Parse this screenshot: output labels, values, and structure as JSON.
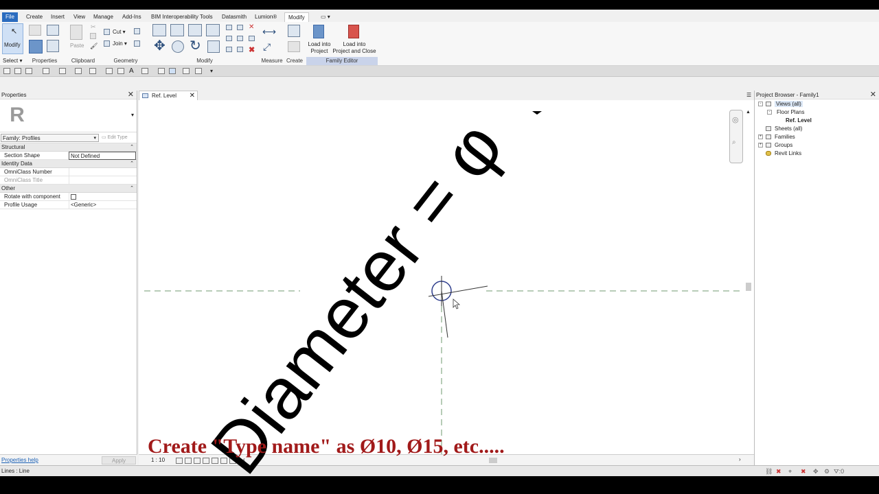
{
  "tabs": [
    "File",
    "Create",
    "Insert",
    "View",
    "Manage",
    "Add-Ins",
    "BIM Interoperability Tools",
    "Datasmith",
    "Lumion®",
    "Modify"
  ],
  "ribbon": {
    "modify_label": "Modify",
    "select_label": "Select",
    "cut_label": "Cut",
    "join_label": "Join",
    "paste_label": "Paste",
    "load_into_project": [
      "Load into",
      "Project"
    ],
    "load_into_project_close": [
      "Load into",
      "Project and Close"
    ],
    "panels": {
      "select": "Select",
      "properties": "Properties",
      "clipboard": "Clipboard",
      "geometry": "Geometry",
      "modify": "Modify",
      "measure": "Measure",
      "create": "Create",
      "family_editor": "Family Editor"
    }
  },
  "properties": {
    "title": "Properties",
    "family_selector": "Family: Profiles",
    "edit_type": "Edit Type",
    "groups": [
      {
        "name": "Structural",
        "rows": [
          {
            "k": "Section Shape",
            "v": "Not Defined"
          }
        ]
      },
      {
        "name": "Identity Data",
        "rows": [
          {
            "k": "OmniClass Number",
            "v": ""
          },
          {
            "k": "OmniClass Title",
            "v": ""
          }
        ]
      },
      {
        "name": "Other",
        "rows": [
          {
            "k": "Rotate with component",
            "v": ""
          },
          {
            "k": "Profile Usage",
            "v": "<Generic>"
          }
        ]
      }
    ],
    "help_link": "Properties help",
    "apply_label": "Apply"
  },
  "view": {
    "tab_label": "Ref. Level",
    "scale": "1 : 10"
  },
  "project_browser": {
    "title": "Project Browser - Family1",
    "nodes": [
      "Views (all)",
      "Floor Plans",
      "Ref. Level",
      "Sheets (all)",
      "Families",
      "Groups",
      "Revit Links"
    ]
  },
  "status": {
    "text": "Lines : Line",
    "filter_count": ":0"
  },
  "overlay": {
    "diameter_text": "Diameter = φ",
    "caption": "Create \"Type name\" as Ø10, Ø15, etc....."
  },
  "colors": {
    "file_tab": "#2b6cbf",
    "caption_red": "#a11a1a",
    "family_editor_panel": "#c9d3ea"
  }
}
